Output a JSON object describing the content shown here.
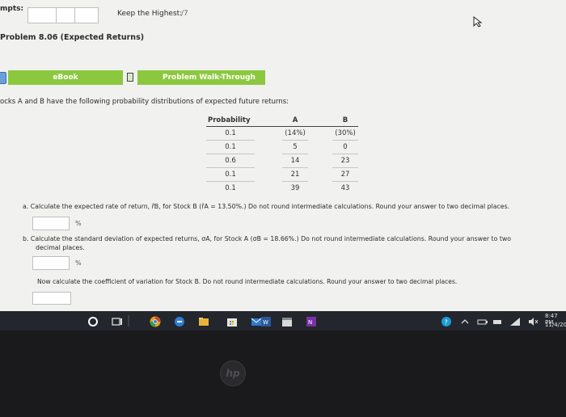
{
  "header": {
    "attempts_label": "mpts:",
    "keep_highest_label": "Keep the Highest:",
    "keep_highest_value": "/7"
  },
  "problem": {
    "title": "Problem 8.06 (Expected Returns)",
    "ebook_label": "eBook",
    "walkthrough_label": "Problem Walk-Through",
    "intro": "ocks A and B have the following probability distributions of expected future returns:"
  },
  "table": {
    "headers": [
      "Probability",
      "A",
      "B"
    ],
    "rows": [
      [
        "0.1",
        "(14%)",
        "(30%)"
      ],
      [
        "0.1",
        "5",
        "0"
      ],
      [
        "0.6",
        "14",
        "23"
      ],
      [
        "0.1",
        "21",
        "27"
      ],
      [
        "0.1",
        "39",
        "43"
      ]
    ]
  },
  "questions": {
    "a": "a. Calculate the expected rate of return, r̂B, for Stock B (r̂A = 13.50%.) Do not round intermediate calculations. Round your answer to two decimal places.",
    "a_unit": "%",
    "b_line1": "b. Calculate the standard deviation of expected returns, σA, for Stock A (σB = 18.66%.) Do not round intermediate calculations. Round your answer to two",
    "b_line2": "decimal places.",
    "b_unit": "%",
    "c": "Now calculate the coefficient of variation for Stock B. Do not round intermediate calculations. Round your answer to two decimal places."
  },
  "taskbar": {
    "time": "8:47 PM",
    "date": "11/4/20"
  },
  "hardware": {
    "brand": "hp"
  }
}
